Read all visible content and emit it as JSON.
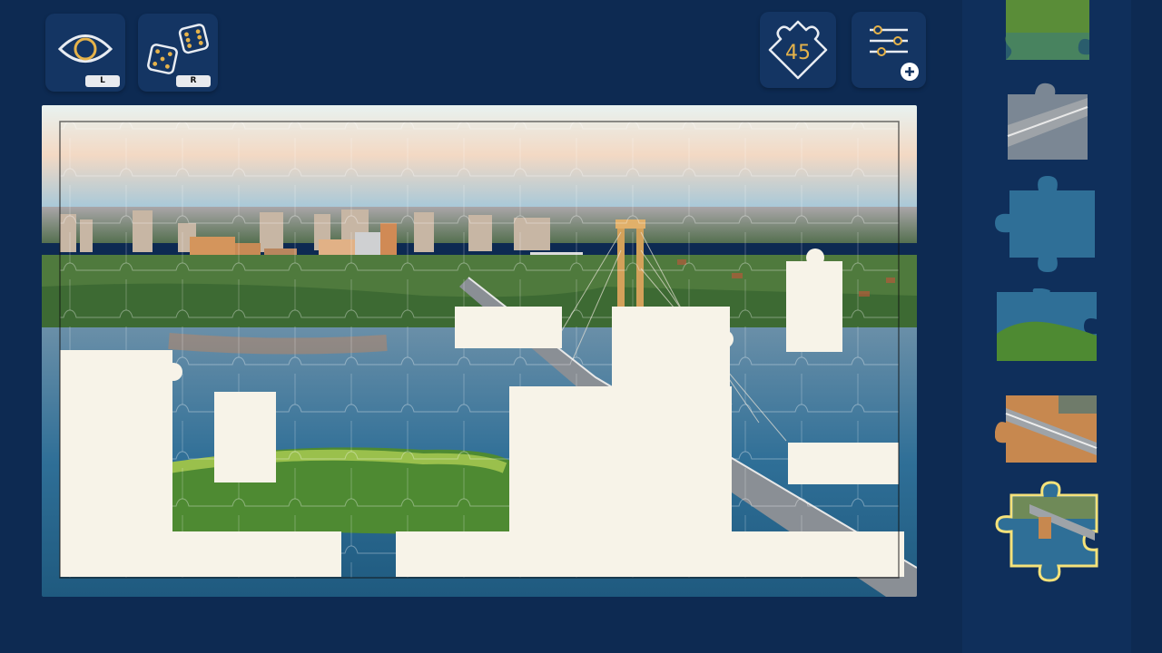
{
  "toolbar": {
    "preview": {
      "icon": "eye-icon",
      "key": "L"
    },
    "shuffle": {
      "icon": "dice-icon",
      "key": "R"
    },
    "pieces_remaining": {
      "icon": "piece-badge-icon",
      "count": "45"
    },
    "settings": {
      "icon": "sliders-icon",
      "extra_icon": "plus-icon"
    }
  },
  "colors": {
    "background": "#0d2a52",
    "button": "#143563",
    "accent": "#e6b34a",
    "empty_slot": "#f7f3e8",
    "selection_outline": "#f5e27a"
  },
  "board": {
    "image_icon": "city-river-bridge-photo"
  },
  "tray": {
    "pieces": [
      {
        "icon": "piece-greenery-icon"
      },
      {
        "icon": "piece-bridge-road-icon"
      },
      {
        "icon": "piece-water-icon"
      },
      {
        "icon": "piece-water-trees-icon"
      },
      {
        "icon": "piece-bridge-icon"
      },
      {
        "icon": "piece-pier-selected-icon",
        "selected": true
      }
    ]
  }
}
